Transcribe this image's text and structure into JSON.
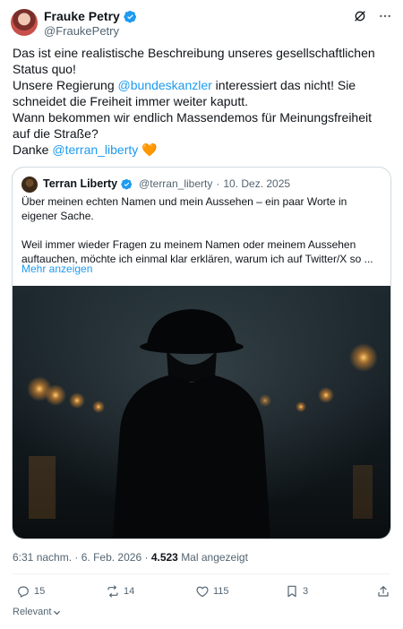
{
  "author": {
    "name": "Frauke Petry",
    "handle": "@FraukePetry"
  },
  "tweet": {
    "line1": "Das ist eine realistische Beschreibung unseres gesellschaftlichen Status quo!",
    "line2_a": "Unsere Regierung ",
    "mention1": "@bundeskanzler",
    "line2_b": " interessiert das nicht! Sie schneidet die Freiheit immer weiter kaputt.",
    "line3": "Wann bekommen wir endlich Massendemos für Meinungsfreiheit auf die Straße?",
    "thanks": "Danke ",
    "mention2": "@terran_liberty",
    "heart": "🧡"
  },
  "quote": {
    "name": "Terran Liberty",
    "handle": "@terran_liberty",
    "separator": "·",
    "date": "10. Dez. 2025",
    "para1": "Über meinen echten Namen und mein Aussehen – ein paar Worte in eigener Sache.",
    "para2": "Weil immer wieder Fragen zu meinem Namen oder meinem Aussehen auftauchen, möchte ich einmal klar erklären, warum ich auf Twitter/X so ...",
    "more": "Mehr anzeigen"
  },
  "meta": {
    "time": "6:31 nachm.",
    "sep1": "·",
    "date": "6. Feb. 2026",
    "sep2": "·",
    "views": "4.523",
    "views_label": "Mal angezeigt"
  },
  "actions": {
    "replies": "15",
    "reposts": "14",
    "likes": "115",
    "bookmarks": "3"
  },
  "sort": {
    "label": "Relevant"
  },
  "colors": {
    "link": "#1d9bf0",
    "verified": "#1d9bf0",
    "text": "#0f1419",
    "muted": "#536471"
  }
}
